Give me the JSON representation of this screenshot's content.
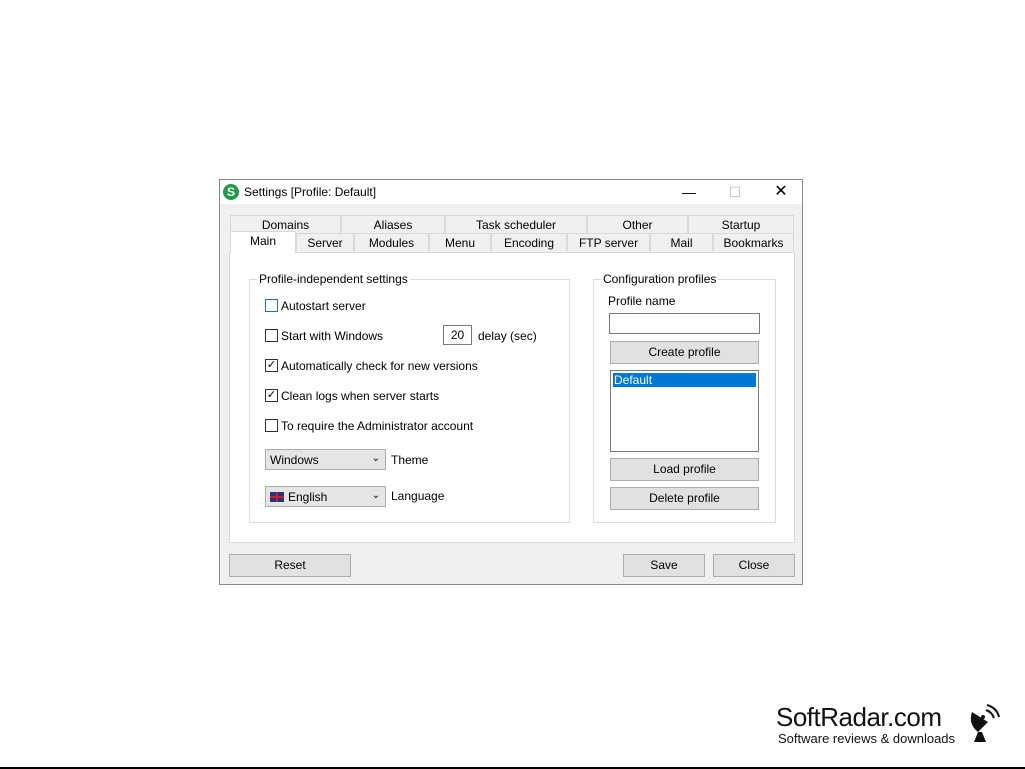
{
  "window": {
    "title": "Settings [Profile: Default]"
  },
  "tabs": {
    "row1": [
      "Domains",
      "Aliases",
      "Task scheduler",
      "Other",
      "Startup"
    ],
    "row2": [
      "Main",
      "Server",
      "Modules",
      "Menu",
      "Encoding",
      "FTP server",
      "Mail",
      "Bookmarks"
    ],
    "active": "Main"
  },
  "profile_independent": {
    "title": "Profile-independent settings",
    "autostart_server": {
      "label": "Autostart server",
      "checked": false
    },
    "start_with_windows": {
      "label": "Start with Windows",
      "checked": false
    },
    "delay_value": "20",
    "delay_label": "delay (sec)",
    "auto_check_versions": {
      "label": "Automatically check for new versions",
      "checked": true
    },
    "clean_logs": {
      "label": "Clean logs when server starts",
      "checked": true
    },
    "require_admin": {
      "label": "To require the Administrator account",
      "checked": false
    },
    "theme": {
      "value": "Windows",
      "label": "Theme"
    },
    "language": {
      "value": "English",
      "label": "Language",
      "flag_icon": "uk-flag-icon"
    }
  },
  "config_profiles": {
    "title": "Configuration profiles",
    "profile_name_label": "Profile name",
    "profile_name_value": "",
    "create_label": "Create profile",
    "profiles": [
      "Default"
    ],
    "selected": "Default",
    "load_label": "Load profile",
    "delete_label": "Delete profile"
  },
  "buttons": {
    "reset": "Reset",
    "save": "Save",
    "close": "Close"
  },
  "brand": {
    "name": "SoftRadar.com",
    "tagline": "Software reviews & downloads"
  },
  "colors": {
    "selection": "#0078d7",
    "app_icon": "#1e9a4a",
    "checkbox_focus": "#1e73be"
  }
}
